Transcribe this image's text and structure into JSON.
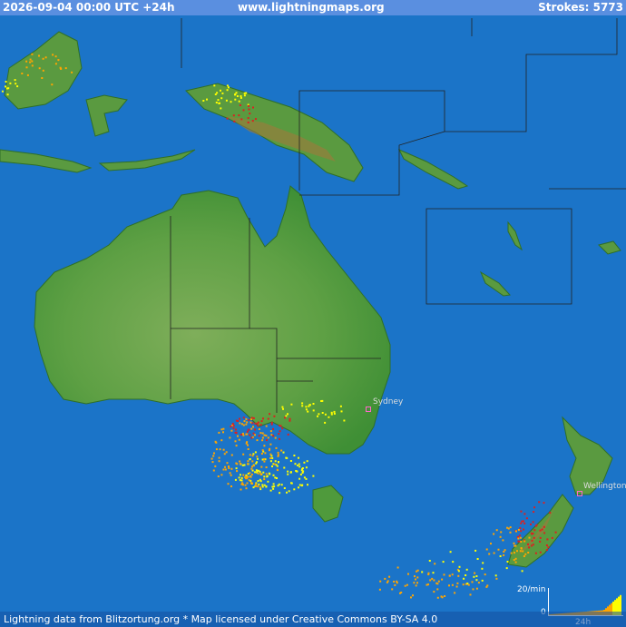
{
  "header": {
    "datetime": "2026-09-04 00:00 UTC +24h",
    "site": "www.lightningmaps.org",
    "strokes": "Strokes: 5773"
  },
  "footer": {
    "credit": "Lightning data from Blitzortung.org  *  Map licensed under Creative Commons BY-SA 4.0"
  },
  "cities": [
    {
      "name": "Sydney"
    },
    {
      "name": "Wellington"
    }
  ],
  "legend": {
    "rate_label": "20/min",
    "zero_label": "0",
    "time_label": "24h"
  },
  "colors": {
    "ocean": "#1b74c8",
    "land": "#4f9a3c",
    "highland": "#a07a3c",
    "strike_recent": "#ffff00",
    "strike_mid": "#ffa500",
    "strike_old": "#dd2020"
  }
}
